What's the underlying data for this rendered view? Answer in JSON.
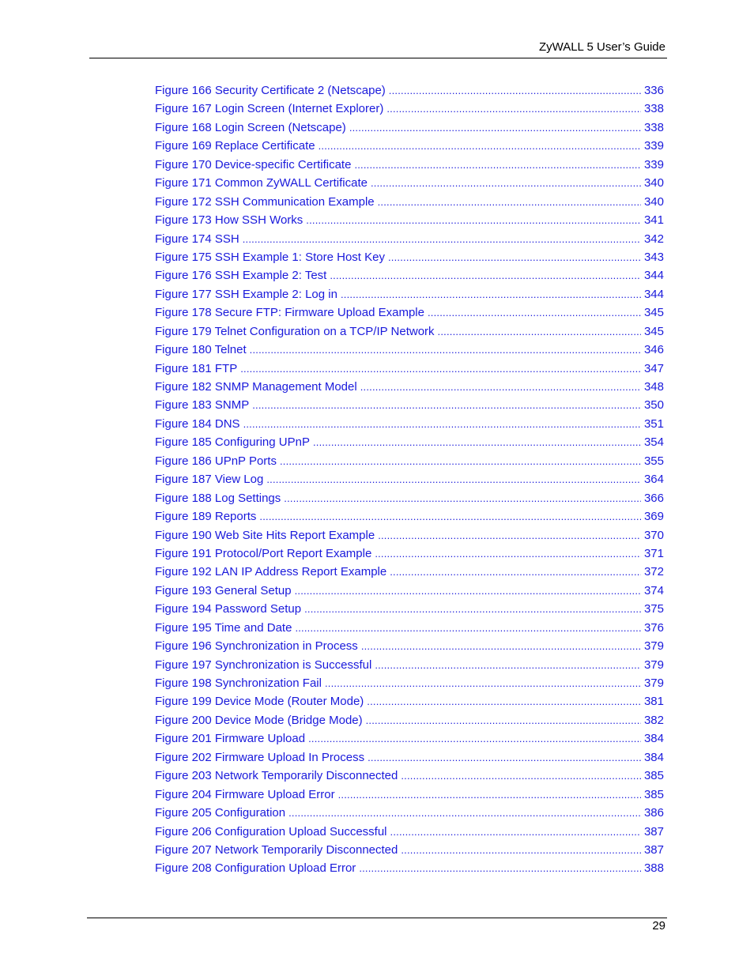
{
  "header": {
    "title": "ZyWALL 5 User’s Guide"
  },
  "link_color": "#1a1adc",
  "entries": [
    {
      "label": "Figure 166 Security Certificate 2 (Netscape)",
      "page": "336"
    },
    {
      "label": "Figure 167 Login Screen (Internet Explorer)",
      "page": "338"
    },
    {
      "label": "Figure 168 Login Screen (Netscape)",
      "page": "338"
    },
    {
      "label": "Figure 169 Replace Certificate",
      "page": "339"
    },
    {
      "label": "Figure 170 Device-specific Certificate",
      "page": "339"
    },
    {
      "label": "Figure 171 Common ZyWALL Certificate",
      "page": "340"
    },
    {
      "label": "Figure 172 SSH Communication Example",
      "page": "340"
    },
    {
      "label": "Figure 173 How SSH Works",
      "page": "341"
    },
    {
      "label": "Figure 174 SSH",
      "page": "342"
    },
    {
      "label": "Figure 175 SSH Example 1: Store Host Key",
      "page": "343"
    },
    {
      "label": "Figure 176 SSH Example 2: Test",
      "page": "344"
    },
    {
      "label": "Figure 177 SSH Example 2: Log in",
      "page": "344"
    },
    {
      "label": "Figure 178 Secure FTP: Firmware Upload Example",
      "page": "345"
    },
    {
      "label": "Figure 179 Telnet Configuration on a TCP/IP Network",
      "page": "345"
    },
    {
      "label": "Figure 180 Telnet",
      "page": "346"
    },
    {
      "label": "Figure 181 FTP",
      "page": "347"
    },
    {
      "label": "Figure 182 SNMP Management Model",
      "page": "348"
    },
    {
      "label": "Figure 183 SNMP",
      "page": "350"
    },
    {
      "label": "Figure 184 DNS",
      "page": "351"
    },
    {
      "label": "Figure 185 Configuring UPnP",
      "page": "354"
    },
    {
      "label": "Figure 186 UPnP Ports",
      "page": "355"
    },
    {
      "label": "Figure 187 View Log",
      "page": "364"
    },
    {
      "label": "Figure 188 Log Settings",
      "page": "366"
    },
    {
      "label": "Figure 189 Reports",
      "page": "369"
    },
    {
      "label": "Figure 190 Web Site Hits Report Example",
      "page": "370"
    },
    {
      "label": "Figure 191 Protocol/Port Report Example",
      "page": "371"
    },
    {
      "label": "Figure 192 LAN IP Address Report Example",
      "page": "372"
    },
    {
      "label": "Figure 193 General Setup",
      "page": "374"
    },
    {
      "label": "Figure 194 Password Setup",
      "page": "375"
    },
    {
      "label": "Figure 195 Time and Date",
      "page": "376"
    },
    {
      "label": "Figure 196 Synchronization in Process",
      "page": "379"
    },
    {
      "label": "Figure 197 Synchronization is Successful",
      "page": "379"
    },
    {
      "label": "Figure 198 Synchronization Fail",
      "page": "379"
    },
    {
      "label": "Figure 199 Device Mode (Router Mode)",
      "page": "381"
    },
    {
      "label": "Figure 200 Device Mode (Bridge Mode)",
      "page": "382"
    },
    {
      "label": "Figure 201 Firmware Upload",
      "page": "384"
    },
    {
      "label": "Figure 202 Firmware Upload In Process",
      "page": "384"
    },
    {
      "label": "Figure 203 Network Temporarily Disconnected",
      "page": "385"
    },
    {
      "label": "Figure 204 Firmware Upload Error",
      "page": "385"
    },
    {
      "label": "Figure 205 Configuration",
      "page": "386"
    },
    {
      "label": "Figure 206 Configuration Upload Successful",
      "page": "387"
    },
    {
      "label": "Figure 207 Network Temporarily Disconnected",
      "page": "387"
    },
    {
      "label": "Figure 208 Configuration Upload Error",
      "page": "388"
    }
  ],
  "footer": {
    "page_number": "29"
  }
}
